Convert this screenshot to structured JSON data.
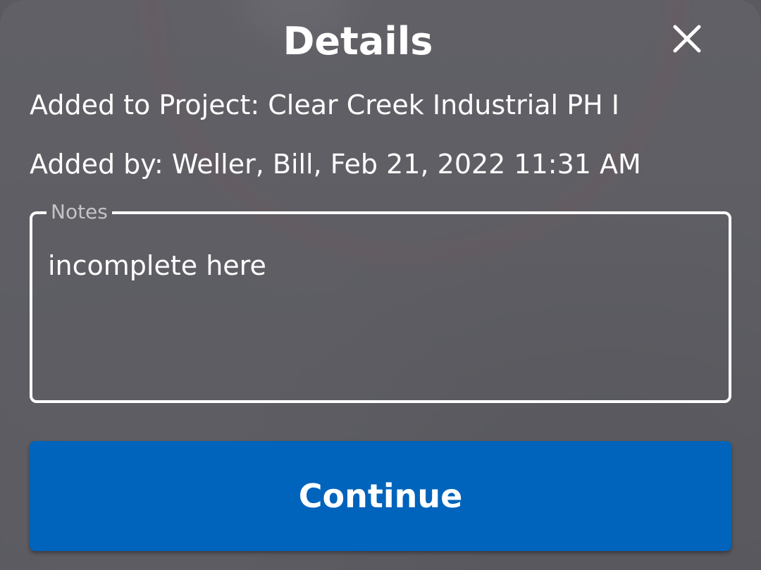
{
  "dialog": {
    "title": "Details",
    "close_icon": "close-icon"
  },
  "info": {
    "project_line": "Added to Project: Clear Creek Industrial PH I",
    "added_by_line": "Added by: Weller, Bill, Feb 21, 2022 11:31 AM"
  },
  "notes": {
    "label": "Notes",
    "value": "incomplete here"
  },
  "actions": {
    "continue_label": "Continue"
  },
  "colors": {
    "accent": "#0063bc",
    "sheet": "#626268",
    "text": "#ffffff"
  }
}
